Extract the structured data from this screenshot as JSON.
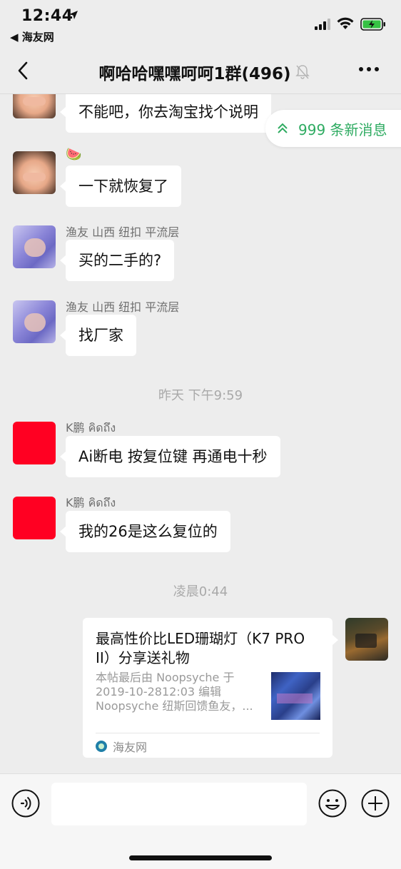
{
  "status_bar": {
    "time": "12:44",
    "back_app": "◀ 海友网"
  },
  "nav": {
    "title": "啊哈哈嘿嘿呵呵1群(496)"
  },
  "new_messages": "999 条新消息",
  "messages": [
    {
      "text": "不能吧，你去淘宝找个说明"
    },
    {
      "sender": "🍉",
      "text": "一下就恢复了"
    },
    {
      "sender": "渔友 山西 纽扣 平流层",
      "text": "买的二手的?"
    },
    {
      "sender": "渔友 山西 纽扣 平流层",
      "text": "找厂家"
    },
    {
      "sender": "K鹏 คิดถึง",
      "text": "Ai断电 按复位键 再通电十秒"
    },
    {
      "sender": "K鹏 คิดถึง",
      "text": "我的26是这么复位的"
    }
  ],
  "timestamps": [
    "昨天 下午9:59",
    "凌晨0:44"
  ],
  "link_card": {
    "title": "最高性价比LED珊瑚灯（K7 PRO II）分享送礼物",
    "desc_lines": [
      "本帖最后由 Noopsyche 于",
      "2019-10-2812:03 编辑",
      "Noopsyche 纽斯回馈鱼友，..."
    ],
    "source": "海友网"
  },
  "input": {
    "placeholder": ""
  },
  "colors": {
    "accent_green": "#2eab61",
    "chat_bg": "#ededed",
    "bubble": "#ffffff",
    "red_avatar": "#ff0022"
  }
}
